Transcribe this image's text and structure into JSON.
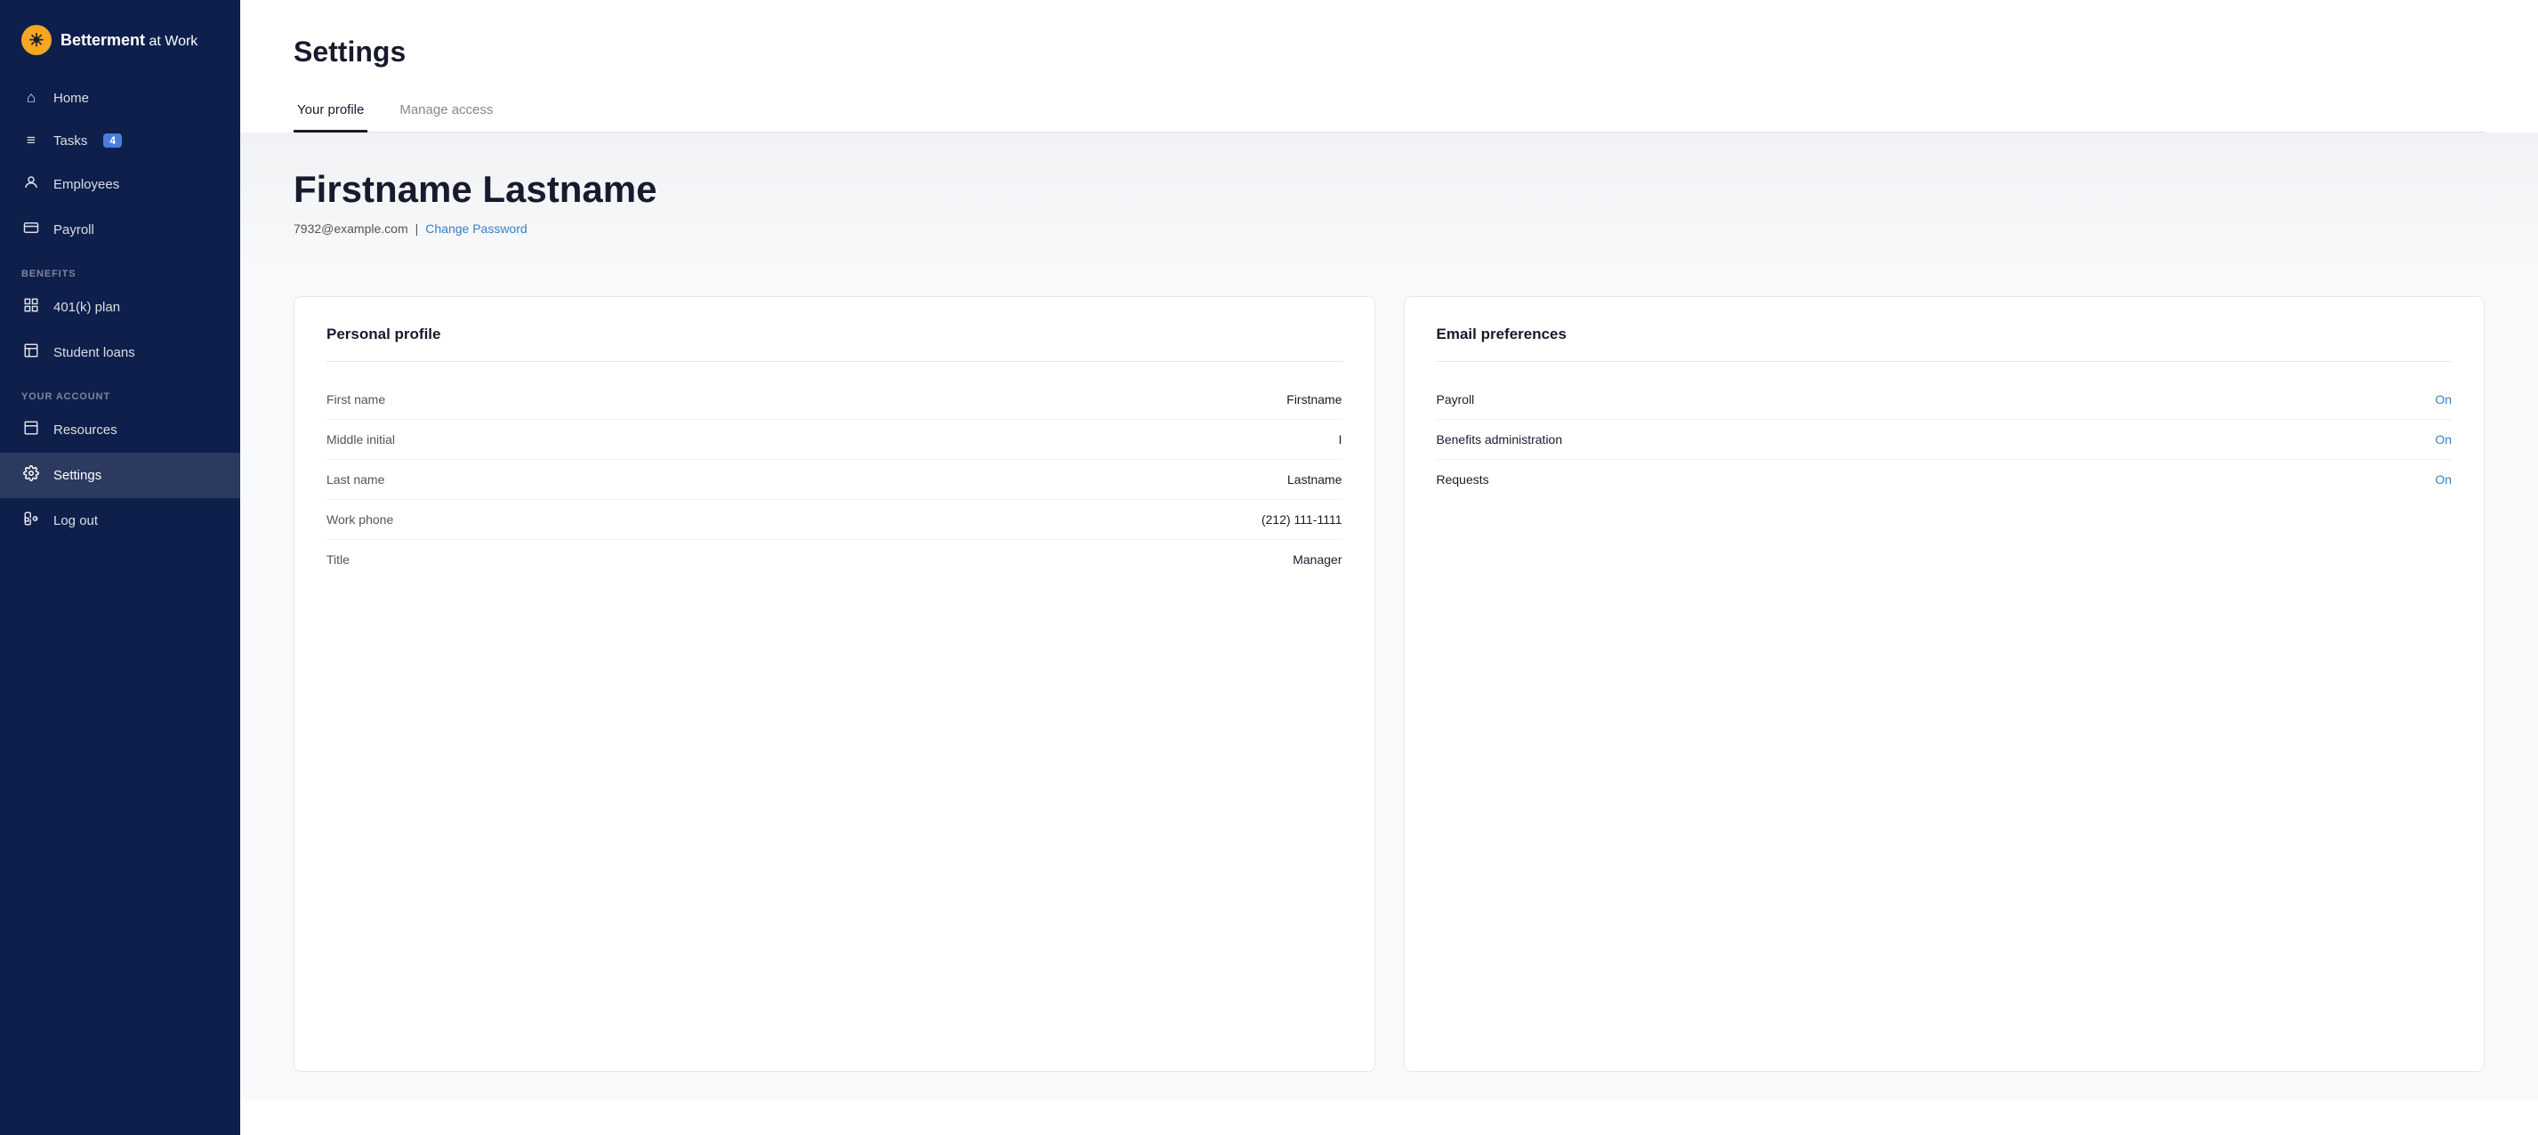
{
  "app": {
    "name": "Betterment",
    "name_suffix": " at Work",
    "logo_emoji": "☀"
  },
  "sidebar": {
    "nav_items": [
      {
        "id": "home",
        "label": "Home",
        "icon": "home",
        "active": false
      },
      {
        "id": "tasks",
        "label": "Tasks",
        "icon": "tasks",
        "badge": "4",
        "active": false
      },
      {
        "id": "employees",
        "label": "Employees",
        "icon": "employees",
        "active": false
      },
      {
        "id": "payroll",
        "label": "Payroll",
        "icon": "payroll",
        "active": false
      }
    ],
    "benefits_section_label": "BENEFITS",
    "benefits_items": [
      {
        "id": "401k",
        "label": "401(k) plan",
        "icon": "401k",
        "active": false
      },
      {
        "id": "student-loans",
        "label": "Student loans",
        "icon": "loans",
        "active": false
      }
    ],
    "account_section_label": "YOUR ACCOUNT",
    "account_items": [
      {
        "id": "resources",
        "label": "Resources",
        "icon": "resources",
        "active": false
      },
      {
        "id": "settings",
        "label": "Settings",
        "icon": "settings",
        "active": true
      },
      {
        "id": "logout",
        "label": "Log out",
        "icon": "logout",
        "active": false
      }
    ]
  },
  "page": {
    "title": "Settings",
    "tabs": [
      {
        "id": "your-profile",
        "label": "Your profile",
        "active": true
      },
      {
        "id": "manage-access",
        "label": "Manage access",
        "active": false
      }
    ]
  },
  "profile": {
    "full_name": "Firstname Lastname",
    "email": "7932@example.com",
    "separator": "|",
    "change_password_label": "Change Password"
  },
  "personal_profile": {
    "card_title": "Personal profile",
    "fields": [
      {
        "label": "First name",
        "value": "Firstname"
      },
      {
        "label": "Middle initial",
        "value": "I"
      },
      {
        "label": "Last name",
        "value": "Lastname"
      },
      {
        "label": "Work phone",
        "value": "(212) 111-1111"
      },
      {
        "label": "Title",
        "value": "Manager"
      }
    ]
  },
  "email_preferences": {
    "card_title": "Email preferences",
    "items": [
      {
        "label": "Payroll",
        "status": "On"
      },
      {
        "label": "Benefits administration",
        "status": "On"
      },
      {
        "label": "Requests",
        "status": "On"
      }
    ]
  }
}
